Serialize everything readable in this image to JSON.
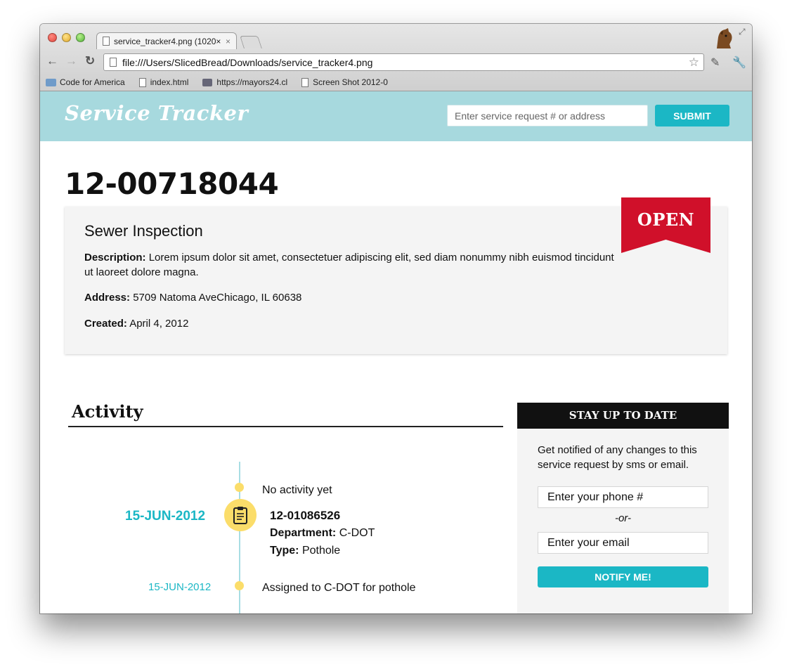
{
  "browser": {
    "tab_title": "service_tracker4.png (1020×",
    "tab_close": "×",
    "url": "file:///Users/SlicedBread/Downloads/service_tracker4.png",
    "bookmarks": [
      "Code for America",
      "index.html",
      "https://mayors24.cl",
      "Screen Shot 2012-0"
    ]
  },
  "header": {
    "logo": "Service Tracker",
    "search_placeholder": "Enter service request # or address",
    "submit_label": "SUBMIT"
  },
  "request": {
    "id": "12-00718044",
    "title": "Sewer Inspection",
    "status": "OPEN",
    "description_label": "Description:",
    "description": "Lorem ipsum dolor sit amet, consectetuer adipiscing elit, sed diam nonummy nibh euismod tincidunt ut laoreet dolore magna.",
    "address_label": "Address:",
    "address": "5709 Natoma AveChicago, IL 60638",
    "created_label": "Created:",
    "created": "April 4, 2012"
  },
  "activity": {
    "heading": "Activity",
    "empty_text": "No activity yet",
    "entry": {
      "date": "15-JUN-2012",
      "id": "12-01086526",
      "department_label": "Department:",
      "department": "C-DOT",
      "type_label": "Type:",
      "type": "Pothole"
    },
    "event": {
      "date": "15-JUN-2012",
      "text": "Assigned to C-DOT for pothole"
    }
  },
  "notify": {
    "heading": "STAY UP TO DATE",
    "text": "Get notified of any changes to this service request by sms or email.",
    "phone_placeholder": "Enter your phone #",
    "or_text": "-or-",
    "email_placeholder": "Enter your email",
    "button_label": "NOTIFY ME!"
  },
  "colors": {
    "header_bg": "#a7d9de",
    "accent": "#1bb7c5",
    "status_open": "#d0102a",
    "timeline_dot": "#fbdd6a"
  }
}
